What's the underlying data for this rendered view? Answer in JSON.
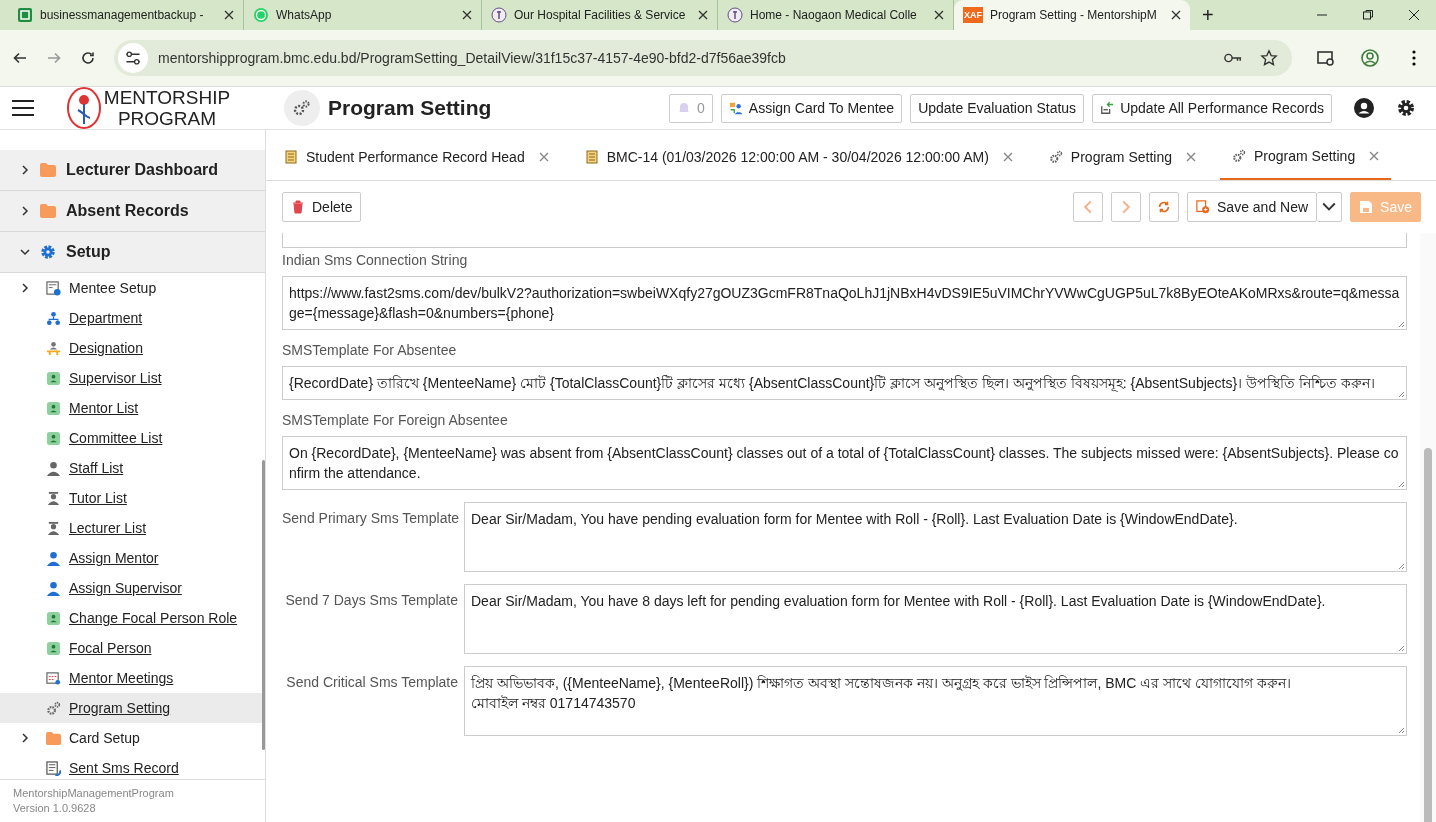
{
  "browser": {
    "tabs": [
      {
        "title": "businessmanagementbackup - ",
        "kind": "sheet",
        "selected": false
      },
      {
        "title": "WhatsApp",
        "kind": "chat",
        "selected": false
      },
      {
        "title": "Our Hospital Facilities & Service",
        "kind": "crest",
        "selected": false
      },
      {
        "title": "Home - Naogaon Medical Colle",
        "kind": "crest",
        "selected": false
      },
      {
        "title": "Program Setting - MentorshipM",
        "kind": "xaf",
        "selected": true
      }
    ],
    "favicon_text": "XAF",
    "new_tab": "+",
    "address": "mentorshipprogram.bmc.edu.bd/ProgramSetting_DetailView/31f15c37-4157-4e90-bfd2-d7f56ae39fcb"
  },
  "header": {
    "brand_line_1": "MENTORSHIP",
    "brand_line_2": "PROGRAM",
    "title": "Program Setting",
    "notification_count": "0",
    "buttons": [
      {
        "label": "Assign Card To Mentee",
        "kind": "card"
      },
      {
        "label": "Update Evaluation Status",
        "kind": "plain"
      },
      {
        "label": "Update All Performance Records",
        "kind": "update"
      }
    ]
  },
  "sidebar": {
    "groups": [
      {
        "label": "Lecturer Dashboard",
        "kind": "folder",
        "expanded": false
      },
      {
        "label": "Absent Records",
        "kind": "folder",
        "expanded": false
      },
      {
        "label": "Setup",
        "kind": "gear",
        "expanded": true,
        "children": [
          {
            "label": "Mentee Setup",
            "kind": "info-card",
            "expanded": false,
            "selected": false
          },
          {
            "label": "Department",
            "kind": "org",
            "selected": false
          },
          {
            "label": "Designation",
            "kind": "desk",
            "selected": false
          },
          {
            "label": "Supervisor List",
            "kind": "badge",
            "selected": false
          },
          {
            "label": "Mentor List",
            "kind": "badge",
            "selected": false
          },
          {
            "label": "Committee List",
            "kind": "badge",
            "selected": false
          },
          {
            "label": "Staff List",
            "kind": "person",
            "selected": false
          },
          {
            "label": "Tutor List",
            "kind": "tutor",
            "selected": false
          },
          {
            "label": "Lecturer List",
            "kind": "tutor",
            "selected": false
          },
          {
            "label": "Assign Mentor",
            "kind": "user",
            "selected": false
          },
          {
            "label": "Assign Supervisor",
            "kind": "user",
            "selected": false
          },
          {
            "label": "Change Focal Person Role",
            "kind": "badge",
            "selected": false
          },
          {
            "label": "Focal Person",
            "kind": "badge",
            "selected": false
          },
          {
            "label": "Mentor Meetings",
            "kind": "calendar",
            "selected": false
          },
          {
            "label": "Program Setting",
            "kind": "gears",
            "selected": true
          },
          {
            "label": "Card Setup",
            "kind": "folder",
            "expanded": false,
            "selected": false
          },
          {
            "label": "Sent Sms Record",
            "kind": "doc",
            "selected": false
          }
        ]
      }
    ],
    "footer_app": "MentorshipManagementProgram",
    "footer_version": "Version 1.0.9628"
  },
  "view_tabs": [
    {
      "label": "Student Performance Record Head",
      "kind": "doc",
      "selected": false
    },
    {
      "label": "BMC-14 (01/03/2026 12:00:00 AM - 30/04/2026 12:00:00 AM)",
      "kind": "doc",
      "selected": false
    },
    {
      "label": "Program Setting",
      "kind": "gears",
      "selected": false
    },
    {
      "label": "Program Setting",
      "kind": "gears",
      "selected": true
    }
  ],
  "toolbar": {
    "delete": "Delete",
    "save_and_new": "Save and New",
    "save": "Save",
    "save_disabled": true
  },
  "fields": [
    {
      "label": "Indian Sms Connection String",
      "kind": "stacked",
      "value": "https://www.fast2sms.com/dev/bulkV2?authorization=swbeiWXqfy27gOUZ3GcmFR8TnaQoLhJ1jNBxH4vDS9IE5uVIMChrYVWwCgUGP5uL7k8ByEOteAKoMRxs&route=q&message={message}&flash=0&numbers={phone}"
    },
    {
      "label": "SMSTemplate For Absentee",
      "kind": "stacked",
      "value": "{RecordDate} তারিখে {MenteeName} মোট {TotalClassCount}টি ক্লাসের মধ্যে {AbsentClassCount}টি ক্লাসে অনুপস্থিত ছিল। অনুপস্থিত বিষয়সমূহ: {AbsentSubjects}। উপস্থিতি নিশ্চিত করুন।"
    },
    {
      "label": "SMSTemplate For Foreign Absentee",
      "kind": "stacked",
      "value": "On {RecordDate}, {MenteeName} was absent from {AbsentClassCount} classes out of a total of {TotalClassCount} classes. The subjects missed were: {AbsentSubjects}. Please confirm the attendance."
    },
    {
      "label": "Send Primary Sms Template",
      "kind": "inline",
      "value": "Dear Sir/Madam, You have pending evaluation form for Mentee with Roll - {Roll}. Last Evaluation Date is {WindowEndDate}."
    },
    {
      "label": "Send 7 Days Sms Template",
      "kind": "inline",
      "value": "Dear Sir/Madam, You have 8 days left for pending evaluation form for Mentee with Roll - {Roll}. Last Evaluation Date is {WindowEndDate}."
    },
    {
      "label": "Send Critical Sms Template",
      "kind": "inline",
      "value": "প্রিয় অভিভাবক, ({MenteeName}, {MenteeRoll}) শিক্ষাগত অবস্থা সন্তোষজনক নয়। অনুগ্রহ করে ভাইস প্রিন্সিপাল, BMC এর সাথে যোগাযোগ করুন।\nমোবাইল নম্বর 01714743570"
    }
  ]
}
